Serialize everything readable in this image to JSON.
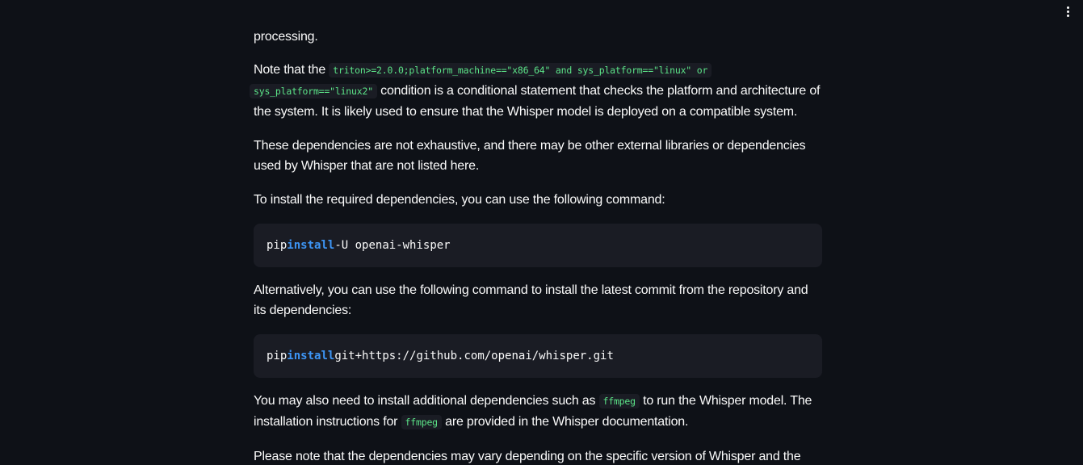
{
  "menu": {
    "icon": "kebab-menu-icon"
  },
  "paragraphs": {
    "p0": {
      "text": "processing."
    },
    "p1": {
      "t1": "Note that the ",
      "c1": "triton>=2.0.0;platform_machine==\"x86_64\" and sys_platform==\"linux\" or",
      "c2": "sys_platform==\"linux2\"",
      "t2": " condition is a conditional statement that checks the platform and architecture of the system. It is likely used to ensure that the Whisper model is deployed on a compatible system."
    },
    "p2": {
      "text": "These dependencies are not exhaustive, and there may be other external libraries or dependencies used by Whisper that are not listed here."
    },
    "p3": {
      "text": "To install the required dependencies, you can use the following command:"
    },
    "p4": {
      "text": "Alternatively, you can use the following command to install the latest commit from the repository and its dependencies:"
    },
    "p5": {
      "t1": "You may also need to install additional dependencies such as ",
      "c1": "ffmpeg",
      "t2": " to run the Whisper model. The installation instructions for ",
      "c2": "ffmpeg",
      "t3": " are provided in the Whisper documentation."
    },
    "p6": {
      "text": "Please note that the dependencies may vary depending on the specific version of Whisper and the"
    }
  },
  "code_blocks": {
    "b1": {
      "cmd": "pip",
      "kw": "install",
      "args": "-U openai-whisper"
    },
    "b2": {
      "cmd": "pip",
      "kw": "install",
      "args": "git+https://github.com/openai/whisper.git"
    }
  },
  "colors": {
    "background": "#0e1117",
    "text": "#fafafa",
    "code_bg": "#1a1c24",
    "inline_code": "#5ce488",
    "keyword": "#3d95f5"
  }
}
